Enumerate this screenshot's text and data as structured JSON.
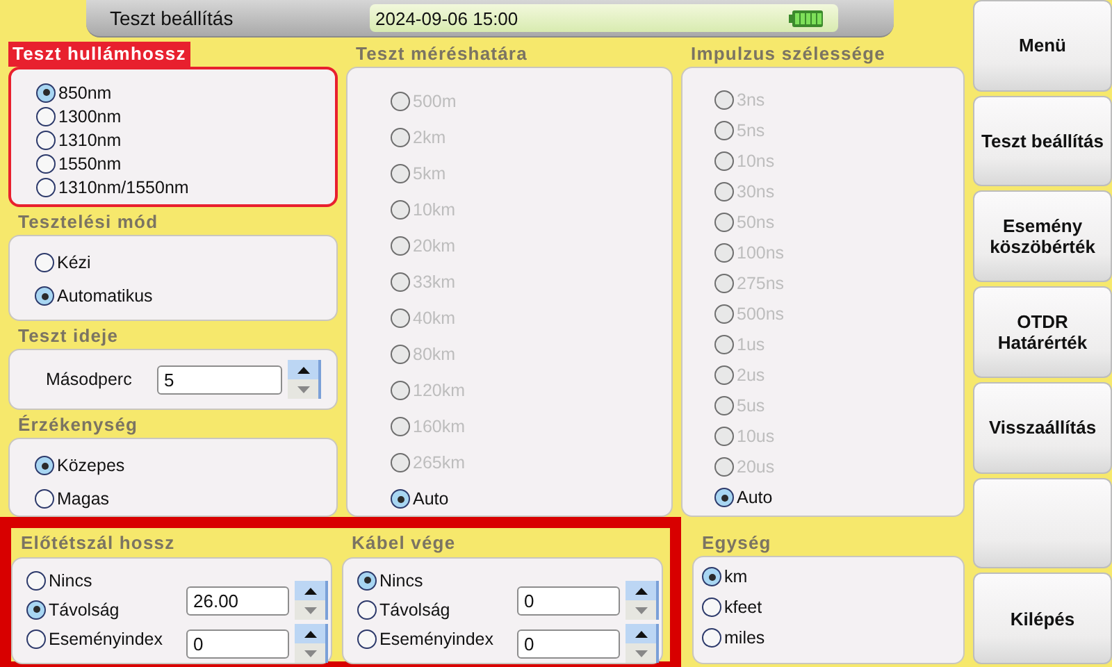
{
  "header": {
    "title": "Teszt beállítás",
    "datetime": "2024-09-06 15:00"
  },
  "wavelength": {
    "title": "Teszt hullámhossz",
    "highlighted": true,
    "options": [
      {
        "label": "850nm",
        "selected": true,
        "disabled": false
      },
      {
        "label": "1300nm",
        "selected": false,
        "disabled": false
      },
      {
        "label": "1310nm",
        "selected": false,
        "disabled": false
      },
      {
        "label": "1550nm",
        "selected": false,
        "disabled": false
      },
      {
        "label": "1310nm/1550nm",
        "selected": false,
        "disabled": false
      }
    ]
  },
  "test_mode": {
    "title": "Tesztelési mód",
    "highlighted": false,
    "options": [
      {
        "label": "Kézi",
        "selected": false,
        "disabled": false
      },
      {
        "label": "Automatikus",
        "selected": true,
        "disabled": false
      }
    ]
  },
  "test_time": {
    "title": "Teszt ideje",
    "label": "Másodperc",
    "value": "5"
  },
  "sensitivity": {
    "title": "Érzékenység",
    "highlighted": false,
    "options": [
      {
        "label": "Közepes",
        "selected": true,
        "disabled": false
      },
      {
        "label": "Magas",
        "selected": false,
        "disabled": false
      }
    ]
  },
  "range": {
    "title": "Teszt méréshatára",
    "highlighted": false,
    "options": [
      {
        "label": "500m",
        "selected": false,
        "disabled": true
      },
      {
        "label": "2km",
        "selected": false,
        "disabled": true
      },
      {
        "label": "5km",
        "selected": false,
        "disabled": true
      },
      {
        "label": "10km",
        "selected": false,
        "disabled": true
      },
      {
        "label": "20km",
        "selected": false,
        "disabled": true
      },
      {
        "label": "33km",
        "selected": false,
        "disabled": true
      },
      {
        "label": "40km",
        "selected": false,
        "disabled": true
      },
      {
        "label": "80km",
        "selected": false,
        "disabled": true
      },
      {
        "label": "120km",
        "selected": false,
        "disabled": true
      },
      {
        "label": "160km",
        "selected": false,
        "disabled": true
      },
      {
        "label": "265km",
        "selected": false,
        "disabled": true
      },
      {
        "label": "Auto",
        "selected": true,
        "disabled": false
      }
    ]
  },
  "pulse_width": {
    "title": "Impulzus szélessége",
    "highlighted": false,
    "options": [
      {
        "label": "3ns",
        "selected": false,
        "disabled": true
      },
      {
        "label": "5ns",
        "selected": false,
        "disabled": true
      },
      {
        "label": "10ns",
        "selected": false,
        "disabled": true
      },
      {
        "label": "30ns",
        "selected": false,
        "disabled": true
      },
      {
        "label": "50ns",
        "selected": false,
        "disabled": true
      },
      {
        "label": "100ns",
        "selected": false,
        "disabled": true
      },
      {
        "label": "275ns",
        "selected": false,
        "disabled": true
      },
      {
        "label": "500ns",
        "selected": false,
        "disabled": true
      },
      {
        "label": "1us",
        "selected": false,
        "disabled": true
      },
      {
        "label": "2us",
        "selected": false,
        "disabled": true
      },
      {
        "label": "5us",
        "selected": false,
        "disabled": true
      },
      {
        "label": "10us",
        "selected": false,
        "disabled": true
      },
      {
        "label": "20us",
        "selected": false,
        "disabled": true
      },
      {
        "label": "Auto",
        "selected": true,
        "disabled": false
      }
    ]
  },
  "launch_fiber": {
    "title": "Előtétszál hossz",
    "options": [
      {
        "label": "Nincs",
        "selected": false,
        "disabled": false
      },
      {
        "label": "Távolság",
        "selected": true,
        "disabled": false
      },
      {
        "label": "Eseményindex",
        "selected": false,
        "disabled": false
      }
    ],
    "fields": [
      {
        "value": "26.00"
      },
      {
        "value": "0"
      }
    ]
  },
  "cable_end": {
    "title": "Kábel vége",
    "options": [
      {
        "label": "Nincs",
        "selected": true,
        "disabled": false
      },
      {
        "label": "Távolság",
        "selected": false,
        "disabled": false
      },
      {
        "label": "Eseményindex",
        "selected": false,
        "disabled": false
      }
    ],
    "fields": [
      {
        "value": "0"
      },
      {
        "value": "0"
      }
    ]
  },
  "unit": {
    "title": "Egység",
    "highlighted": false,
    "options": [
      {
        "label": "km",
        "selected": true,
        "disabled": false
      },
      {
        "label": "kfeet",
        "selected": false,
        "disabled": false
      },
      {
        "label": "miles",
        "selected": false,
        "disabled": false
      }
    ]
  },
  "sidebar": {
    "buttons": [
      {
        "kind": "label",
        "label": "Menü"
      },
      {
        "kind": "label",
        "label": "Teszt beállítás"
      },
      {
        "kind": "label",
        "label": "Esemény köszöbérték"
      },
      {
        "kind": "label",
        "label": "OTDR Határérték"
      },
      {
        "kind": "label",
        "label": "Visszaállítás"
      },
      {
        "kind": "blank"
      },
      {
        "kind": "label",
        "label": "Kilépés"
      }
    ]
  }
}
